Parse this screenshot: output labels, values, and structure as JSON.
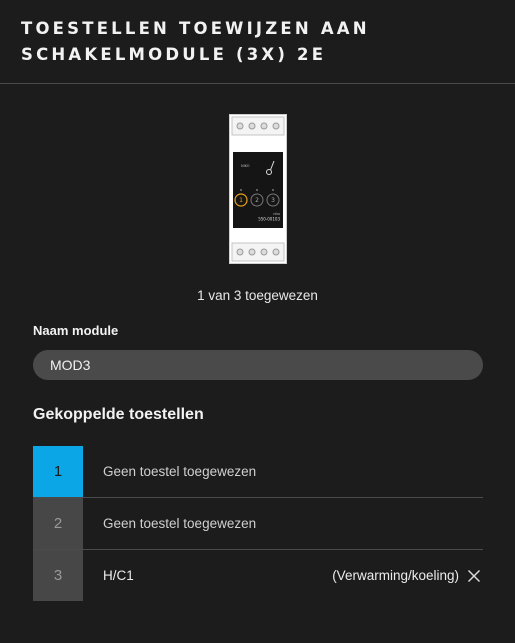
{
  "header": {
    "title": "TOESTELLEN TOEWIJZEN AAN SCHAKELMODULE (3X) 2E"
  },
  "module": {
    "status": "1 van 3 toegewezen",
    "image": {
      "brand": "NIKO",
      "sub_brand": "niko",
      "model": "550-00103",
      "channels": [
        "1",
        "2",
        "3"
      ]
    }
  },
  "form": {
    "label": "Naam module",
    "value": "MOD3"
  },
  "devices": {
    "title": "Gekoppelde toestellen",
    "rows": [
      {
        "number": "1",
        "name": "Geen toestel toegewezen",
        "type": ""
      },
      {
        "number": "2",
        "name": "Geen toestel toegewezen",
        "type": ""
      },
      {
        "number": "3",
        "name": "H/C1",
        "type": "(Verwarming/koeling)",
        "remove_icon": "close-icon"
      }
    ]
  },
  "colors": {
    "background": "#1c1c1c",
    "accent": "#0aa6e6",
    "input": "#4a4a4a"
  }
}
